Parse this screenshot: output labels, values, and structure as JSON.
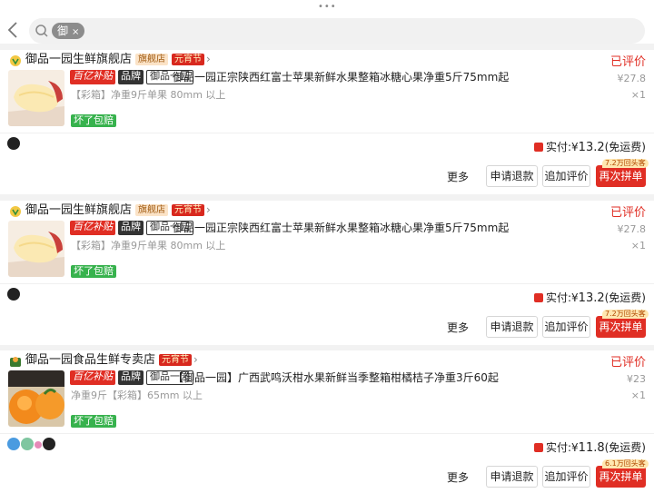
{
  "header": {
    "search_tag": "御",
    "search_tag_close": "×"
  },
  "orders": [
    {
      "shop_name": "御品一园生鲜旗舰店",
      "shop_tag": "旗舰店",
      "promo_tag": "元宵节",
      "status": "已评价",
      "badge_subsidy": "百亿补贴",
      "badge_brand": "品牌",
      "badge_brand_name": "御品一园",
      "title": "御品一园正宗陕西红富士苹果新鲜水果整箱冰糖心果净重5斤75mm起",
      "spec": "【彩箱】净重9斤单果 80mm 以上",
      "price": "¥27.8",
      "quantity": "×1",
      "ship_tag": "坏了包赔",
      "paid_label": "实付:",
      "paid_currency": "¥",
      "paid_amount": "13.2",
      "paid_note": "(免运费)",
      "rebuy_badge": "7.2万回头客",
      "more": "更多",
      "refund": "申请退款",
      "add_review": "追加评价",
      "rebuy": "再次拼单"
    },
    {
      "shop_name": "御品一园生鲜旗舰店",
      "shop_tag": "旗舰店",
      "promo_tag": "元宵节",
      "status": "已评价",
      "badge_subsidy": "百亿补贴",
      "badge_brand": "品牌",
      "badge_brand_name": "御品一园",
      "title": "御品一园正宗陕西红富士苹果新鲜水果整箱冰糖心果净重5斤75mm起",
      "spec": "【彩箱】净重9斤单果 80mm 以上",
      "price": "¥27.8",
      "quantity": "×1",
      "ship_tag": "坏了包赔",
      "paid_label": "实付:",
      "paid_currency": "¥",
      "paid_amount": "13.2",
      "paid_note": "(免运费)",
      "rebuy_badge": "7.2万回头客",
      "more": "更多",
      "refund": "申请退款",
      "add_review": "追加评价",
      "rebuy": "再次拼单"
    },
    {
      "shop_name": "御品一园食品生鲜专卖店",
      "promo_tag": "元宵节",
      "status": "已评价",
      "badge_subsidy": "百亿补贴",
      "badge_brand": "品牌",
      "badge_brand_name": "御品一园",
      "title": "【御品一园】广西武鸣沃柑水果新鲜当季整箱柑橘桔子净重3斤60起",
      "spec": "净重9斤【彩箱】65mm 以上",
      "price": "¥23",
      "quantity": "×1",
      "ship_tag": "坏了包赔",
      "paid_label": "实付:",
      "paid_currency": "¥",
      "paid_amount": "11.8",
      "paid_note": "(免运费)",
      "rebuy_badge": "6.1万回头客",
      "more": "更多",
      "refund": "申请退款",
      "add_review": "追加评价",
      "rebuy": "再次拼单"
    }
  ],
  "colors": {
    "accent_red": "#e02e24",
    "ship_green": "#37b24d"
  }
}
